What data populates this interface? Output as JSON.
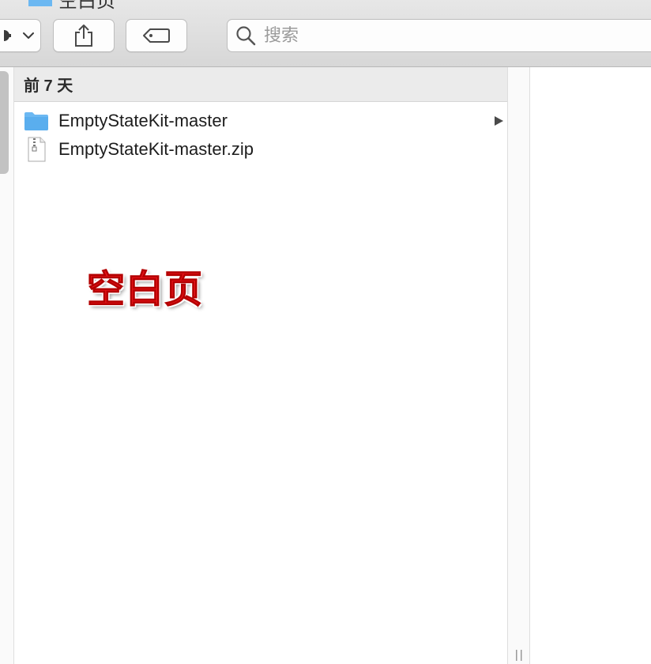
{
  "window": {
    "title": "空白页"
  },
  "toolbar": {
    "action_icon": "gear-icon",
    "action_chevron_icon": "chevron-down-icon",
    "share_icon": "share-icon",
    "tag_icon": "tag-icon"
  },
  "search": {
    "icon": "search-icon",
    "placeholder": "搜索",
    "value": ""
  },
  "column": {
    "section_header": "前 7 天",
    "items": [
      {
        "name": "EmptyStateKit-master",
        "icon": "folder-icon",
        "has_children": true
      },
      {
        "name": "EmptyStateKit-master.zip",
        "icon": "zip-file-icon",
        "has_children": false
      }
    ]
  },
  "annotation": {
    "text": "空白页",
    "color": "#e8131a"
  },
  "colors": {
    "folder_blue": "#6cb8f2",
    "toolbar_bg": "#dcdcdc",
    "header_bg": "#ebebeb"
  }
}
